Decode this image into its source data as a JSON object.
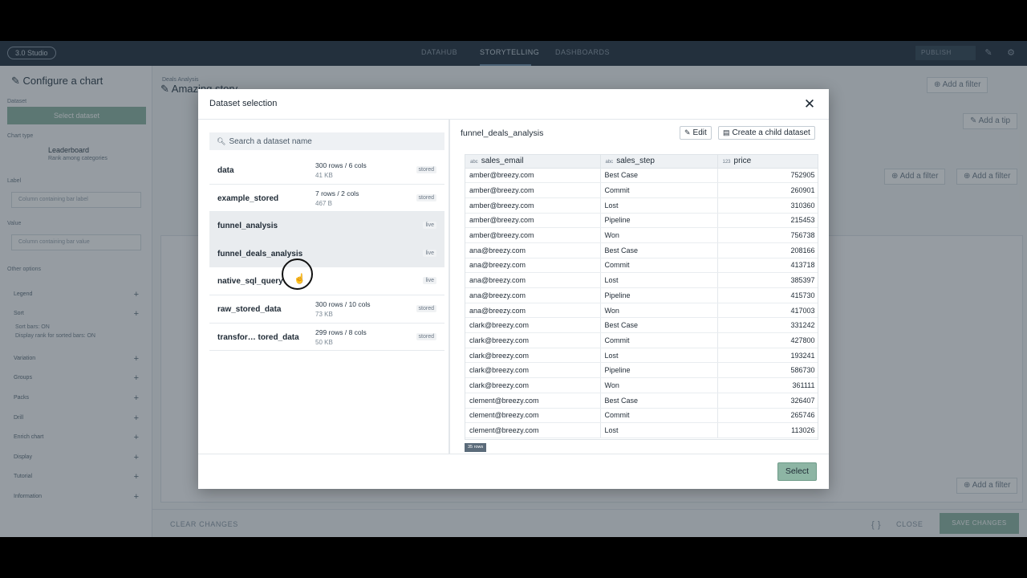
{
  "nav": {
    "app_label": "3.0 Studio",
    "tabs": [
      "DATAHUB",
      "STORYTELLING",
      "DASHBOARDS"
    ],
    "publish": "PUBLISH"
  },
  "background": {
    "configure_title": "Configure a chart",
    "dataset_label": "Dataset",
    "select_dataset": "Select dataset",
    "chart_type_label": "Chart type",
    "chart_type_name": "Leaderboard",
    "chart_type_desc": "Rank among categories",
    "label_label": "Label",
    "label_placeholder": "Column containing bar label",
    "value_label": "Value",
    "value_placeholder": "Column containing bar value",
    "other_options": "Other options",
    "options": [
      "Legend",
      "Sort",
      "Variation",
      "Groups",
      "Packs",
      "Drill",
      "Enrich chart",
      "Display",
      "Tutorial",
      "Information"
    ],
    "sort_note1": "Sort bars: ON",
    "sort_note2": "Display rank for sorted bars: ON",
    "story_breadcrumb": "Deals Analysis",
    "story_title": "Amazing story",
    "add_a_filter": "Add a filter",
    "add_a_tip": "Add a tip",
    "clear_changes": "CLEAR CHANGES",
    "close": "CLOSE",
    "save_changes": "SAVE CHANGES"
  },
  "modal": {
    "title": "Dataset selection",
    "search_placeholder": "Search a dataset name",
    "datasets": [
      {
        "name": "data",
        "meta1": "300 rows / 6 cols",
        "meta2": "41 KB",
        "badge": "stored"
      },
      {
        "name": "example_stored",
        "meta1": "7 rows / 2 cols",
        "meta2": "467 B",
        "badge": "stored"
      },
      {
        "name": "funnel_analysis",
        "meta1": "",
        "meta2": "",
        "badge": "live"
      },
      {
        "name": "funnel_deals_analysis",
        "meta1": "",
        "meta2": "",
        "badge": "live"
      },
      {
        "name": "native_sql_query",
        "meta1": "",
        "meta2": "",
        "badge": "live"
      },
      {
        "name": "raw_stored_data",
        "meta1": "300 rows / 10 cols",
        "meta2": "73 KB",
        "badge": "stored"
      },
      {
        "name": "transfor…  tored_data",
        "meta1": "299 rows / 8 cols",
        "meta2": "50 KB",
        "badge": "stored"
      }
    ],
    "preview_title": "funnel_deals_analysis",
    "edit_label": "Edit",
    "child_label": "Create a child dataset",
    "columns": [
      "sales_email",
      "sales_step",
      "price"
    ],
    "rows": [
      [
        "amber@breezy.com",
        "Best Case",
        "752905"
      ],
      [
        "amber@breezy.com",
        "Commit",
        "260901"
      ],
      [
        "amber@breezy.com",
        "Lost",
        "310360"
      ],
      [
        "amber@breezy.com",
        "Pipeline",
        "215453"
      ],
      [
        "amber@breezy.com",
        "Won",
        "756738"
      ],
      [
        "ana@breezy.com",
        "Best Case",
        "208166"
      ],
      [
        "ana@breezy.com",
        "Commit",
        "413718"
      ],
      [
        "ana@breezy.com",
        "Lost",
        "385397"
      ],
      [
        "ana@breezy.com",
        "Pipeline",
        "415730"
      ],
      [
        "ana@breezy.com",
        "Won",
        "417003"
      ],
      [
        "clark@breezy.com",
        "Best Case",
        "331242"
      ],
      [
        "clark@breezy.com",
        "Commit",
        "427800"
      ],
      [
        "clark@breezy.com",
        "Lost",
        "193241"
      ],
      [
        "clark@breezy.com",
        "Pipeline",
        "586730"
      ],
      [
        "clark@breezy.com",
        "Won",
        "361111"
      ],
      [
        "clement@breezy.com",
        "Best Case",
        "326407"
      ],
      [
        "clement@breezy.com",
        "Commit",
        "265746"
      ],
      [
        "clement@breezy.com",
        "Lost",
        "113026"
      ]
    ],
    "row_count": "35 rows",
    "select_label": "Select"
  }
}
